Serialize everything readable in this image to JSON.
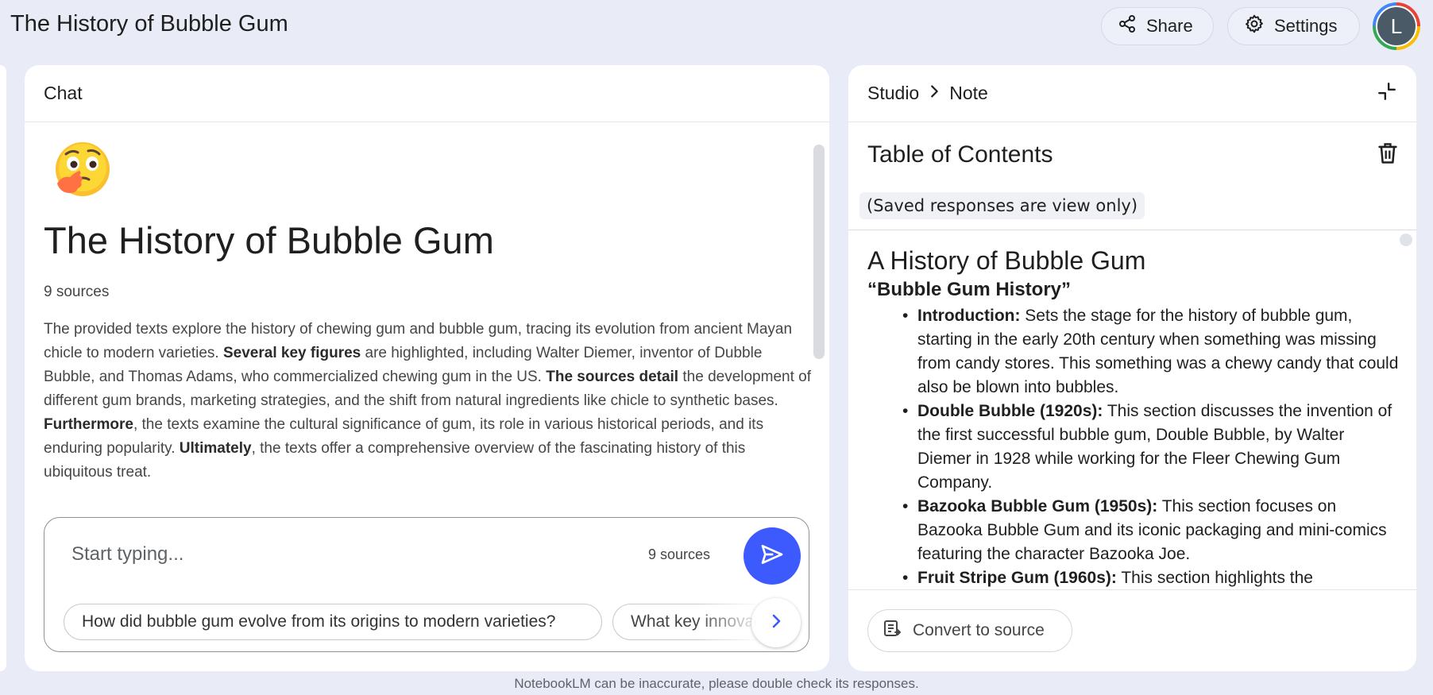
{
  "app": {
    "title": "The History of Bubble Gum"
  },
  "header": {
    "share_label": "Share",
    "settings_label": "Settings",
    "avatar_initial": "L"
  },
  "chat": {
    "panel_title": "Chat",
    "title": "The History of Bubble Gum",
    "sources_count": "9 sources",
    "summary": [
      {
        "text": "The provided texts explore the history of chewing gum and bubble gum, tracing its evolution from ancient Mayan chicle to modern varieties. ",
        "bold": false
      },
      {
        "text": "Several key figures",
        "bold": true
      },
      {
        "text": " are highlighted, including Walter Diemer, inventor of Dubble Bubble, and Thomas Adams, who commercialized chewing gum in the US. ",
        "bold": false
      },
      {
        "text": "The sources detail",
        "bold": true
      },
      {
        "text": " the development of different gum brands, marketing strategies, and the shift from natural ingredients like chicle to synthetic bases. ",
        "bold": false
      },
      {
        "text": "Furthermore",
        "bold": true
      },
      {
        "text": ", the texts examine the cultural significance of gum, its role in various historical periods, and its enduring popularity. ",
        "bold": false
      },
      {
        "text": "Ultimately",
        "bold": true
      },
      {
        "text": ", the texts offer a comprehensive overview of the fascinating history of this ubiquitous treat.",
        "bold": false
      }
    ],
    "composer": {
      "placeholder": "Start typing...",
      "sources_label": "9 sources",
      "suggestions": [
        "How did bubble gum evolve from its origins to modern varieties?",
        "What key innova"
      ]
    }
  },
  "studio": {
    "breadcrumb_root": "Studio",
    "breadcrumb_current": "Note",
    "note_title": "Table of Contents",
    "readonly_notice": "(Saved responses are view only)",
    "note": {
      "heading": "A History of Bubble Gum",
      "subheading": "“Bubble Gum History”",
      "items": [
        {
          "label": "Introduction:",
          "text": " Sets the stage for the history of bubble gum, starting in the early 20th century when something was missing from candy stores. This something was a chewy candy that could also be blown into bubbles."
        },
        {
          "label": "Double Bubble (1920s):",
          "text": " This section discusses the invention of the first successful bubble gum, Double Bubble, by Walter Diemer in 1928 while working for the Fleer Chewing Gum Company."
        },
        {
          "label": "Bazooka Bubble Gum (1950s):",
          "text": " This section focuses on Bazooka Bubble Gum and its iconic packaging and mini-comics featuring the character Bazooka Joe."
        },
        {
          "label": "Fruit Stripe Gum (1960s):",
          "text": " This section highlights the"
        }
      ]
    },
    "convert_label": "Convert to source"
  },
  "footer": {
    "disclaimer": "NotebookLM can be inaccurate, please double check its responses."
  },
  "colors": {
    "background": "#e9ecf7",
    "accent": "#3d5afe",
    "panel": "#ffffff"
  },
  "icons": [
    "share-icon",
    "gear-icon",
    "thinking-face-emoji-icon",
    "send-icon",
    "chevron-right-icon",
    "collapse-icon",
    "trash-icon",
    "convert-source-icon"
  ]
}
